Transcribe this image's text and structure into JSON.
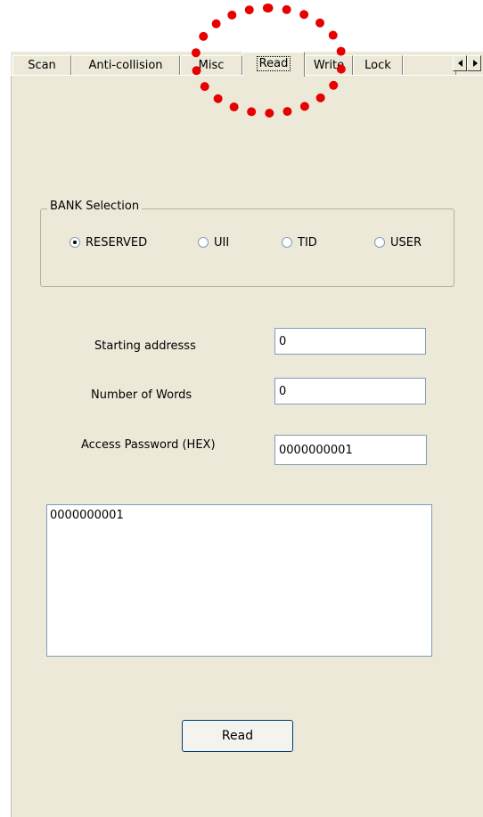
{
  "tabs": [
    {
      "label": "Scan",
      "active": false
    },
    {
      "label": "Anti-collision",
      "active": false
    },
    {
      "label": "Misc",
      "active": false
    },
    {
      "label": "Read",
      "active": true
    },
    {
      "label": "Write",
      "active": false
    },
    {
      "label": "Lock",
      "active": false
    }
  ],
  "tab_scroll": {
    "left_icon": "arrow-left-icon",
    "right_icon": "arrow-right-icon"
  },
  "bank_selection": {
    "title": "BANK Selection",
    "options": [
      {
        "label": "RESERVED",
        "checked": true
      },
      {
        "label": "UII",
        "checked": false
      },
      {
        "label": "TID",
        "checked": false
      },
      {
        "label": "USER",
        "checked": false
      }
    ]
  },
  "fields": {
    "starting_address": {
      "label": "Starting addresss",
      "value": "0"
    },
    "number_of_words": {
      "label": "Number of Words",
      "value": "0"
    },
    "access_password": {
      "label": "Access Password (HEX)",
      "value": "0000000001"
    }
  },
  "output": {
    "value": "0000000001"
  },
  "read_button": {
    "label": "Read"
  },
  "colors": {
    "highlight": "#e60000",
    "panel": "#ece9d8",
    "field_border": "#7f9db9"
  }
}
